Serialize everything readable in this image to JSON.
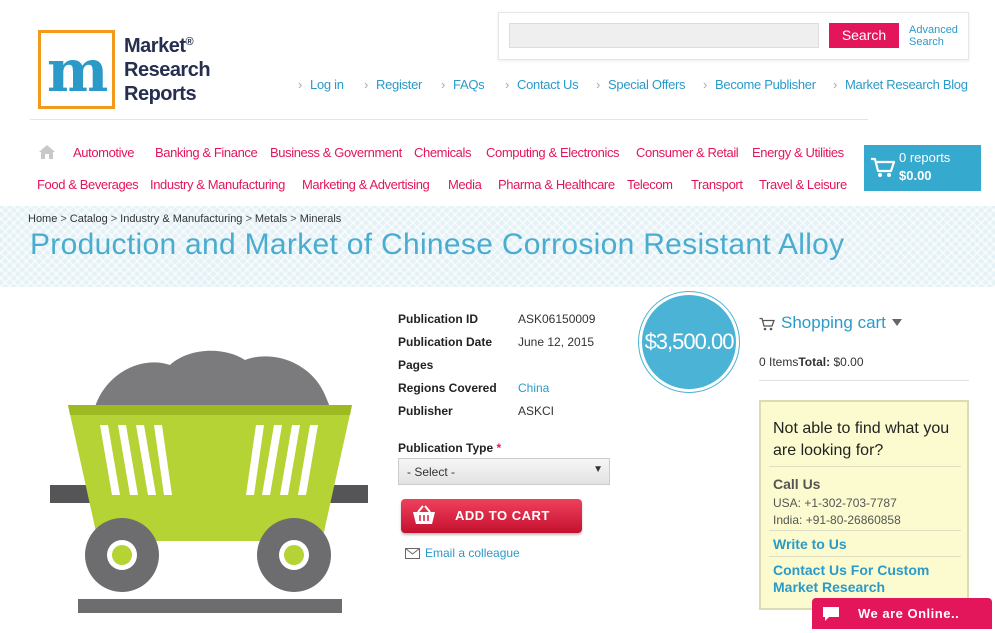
{
  "logo": {
    "line1": "Market",
    "line2": "Research",
    "line3": "Reports",
    "reg": "®",
    "letter": "m"
  },
  "search": {
    "placeholder": "",
    "button": "Search",
    "advanced_line1": "Advanced",
    "advanced_line2": "Search"
  },
  "toplinks": [
    "Log in",
    "Register",
    "FAQs",
    "Contact Us",
    "Special Offers",
    "Become Publisher",
    "Market Research Blog"
  ],
  "nav_row1": [
    "Automotive",
    "Banking & Finance",
    "Business & Government",
    "Chemicals",
    "Computing & Electronics",
    "Consumer & Retail",
    "Energy & Utilities"
  ],
  "nav_row2": [
    "Food & Beverages",
    "Industry & Manufacturing",
    "Marketing & Advertising",
    "Media",
    "Pharma & Healthcare",
    "Telecom",
    "Transport",
    "Travel & Leisure"
  ],
  "cart": {
    "count": "0 reports",
    "total": "$0.00"
  },
  "breadcrumb": [
    "Home",
    "Catalog",
    "Industry & Manufacturing",
    "Metals",
    "Minerals"
  ],
  "title": "Production and Market of Chinese Corrosion Resistant Alloy",
  "details": {
    "publication_id": {
      "label": "Publication ID",
      "value": "ASK06150009"
    },
    "publication_date": {
      "label": "Publication Date",
      "value": "June 12, 2015"
    },
    "pages": {
      "label": "Pages",
      "value": ""
    },
    "regions": {
      "label": "Regions Covered",
      "value": "China"
    },
    "publisher": {
      "label": "Publisher",
      "value": "ASKCI"
    }
  },
  "publication_type": {
    "label": "Publication Type",
    "required": "*",
    "selected": "- Select -"
  },
  "add_to_cart": "ADD TO CART",
  "email_colleague": "Email a colleague",
  "price": "$3,500.00",
  "shopping_cart": {
    "title": "Shopping cart",
    "items": "0 Items",
    "total_label": "Total:",
    "total_value": " $0.00"
  },
  "help": {
    "question": "Not able to find what you are looking for?",
    "call_us": "Call Us",
    "usa": "USA: +1-302-703-7787",
    "india": "India: +91-80-26860858",
    "write_to_us": "Write to Us",
    "custom": "Contact Us For Custom Market Research"
  },
  "online": "We are Online..",
  "colors": {
    "accent_pink": "#e3165b",
    "accent_blue": "#2b9ac9",
    "cart_blue": "#36a9cf",
    "logo_orange": "#f39a1c"
  }
}
